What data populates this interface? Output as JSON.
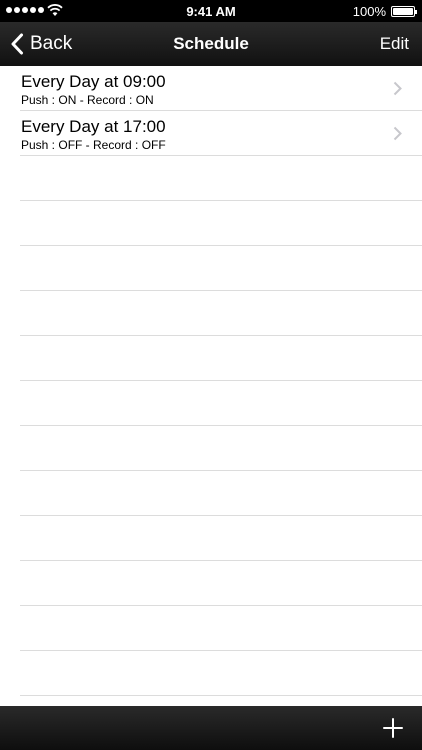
{
  "status_bar": {
    "time": "9:41 AM",
    "battery": "100%"
  },
  "nav": {
    "back_label": "Back",
    "title": "Schedule",
    "edit_label": "Edit"
  },
  "schedules": [
    {
      "title": "Every Day at 09:00",
      "subtitle": "Push : ON - Record : ON"
    },
    {
      "title": "Every Day at 17:00",
      "subtitle": "Push : OFF - Record : OFF"
    }
  ],
  "icons": {
    "back": "chevron-left-icon",
    "row": "chevron-right-icon",
    "add": "plus-icon",
    "wifi": "wifi-icon",
    "battery": "battery-icon",
    "signal": "signal-dots-icon"
  },
  "colors": {
    "bar_background": "#1a1a1a",
    "bar_text": "#ffffff",
    "separator": "#dcdcdc",
    "chevron": "#c7c7cc"
  }
}
